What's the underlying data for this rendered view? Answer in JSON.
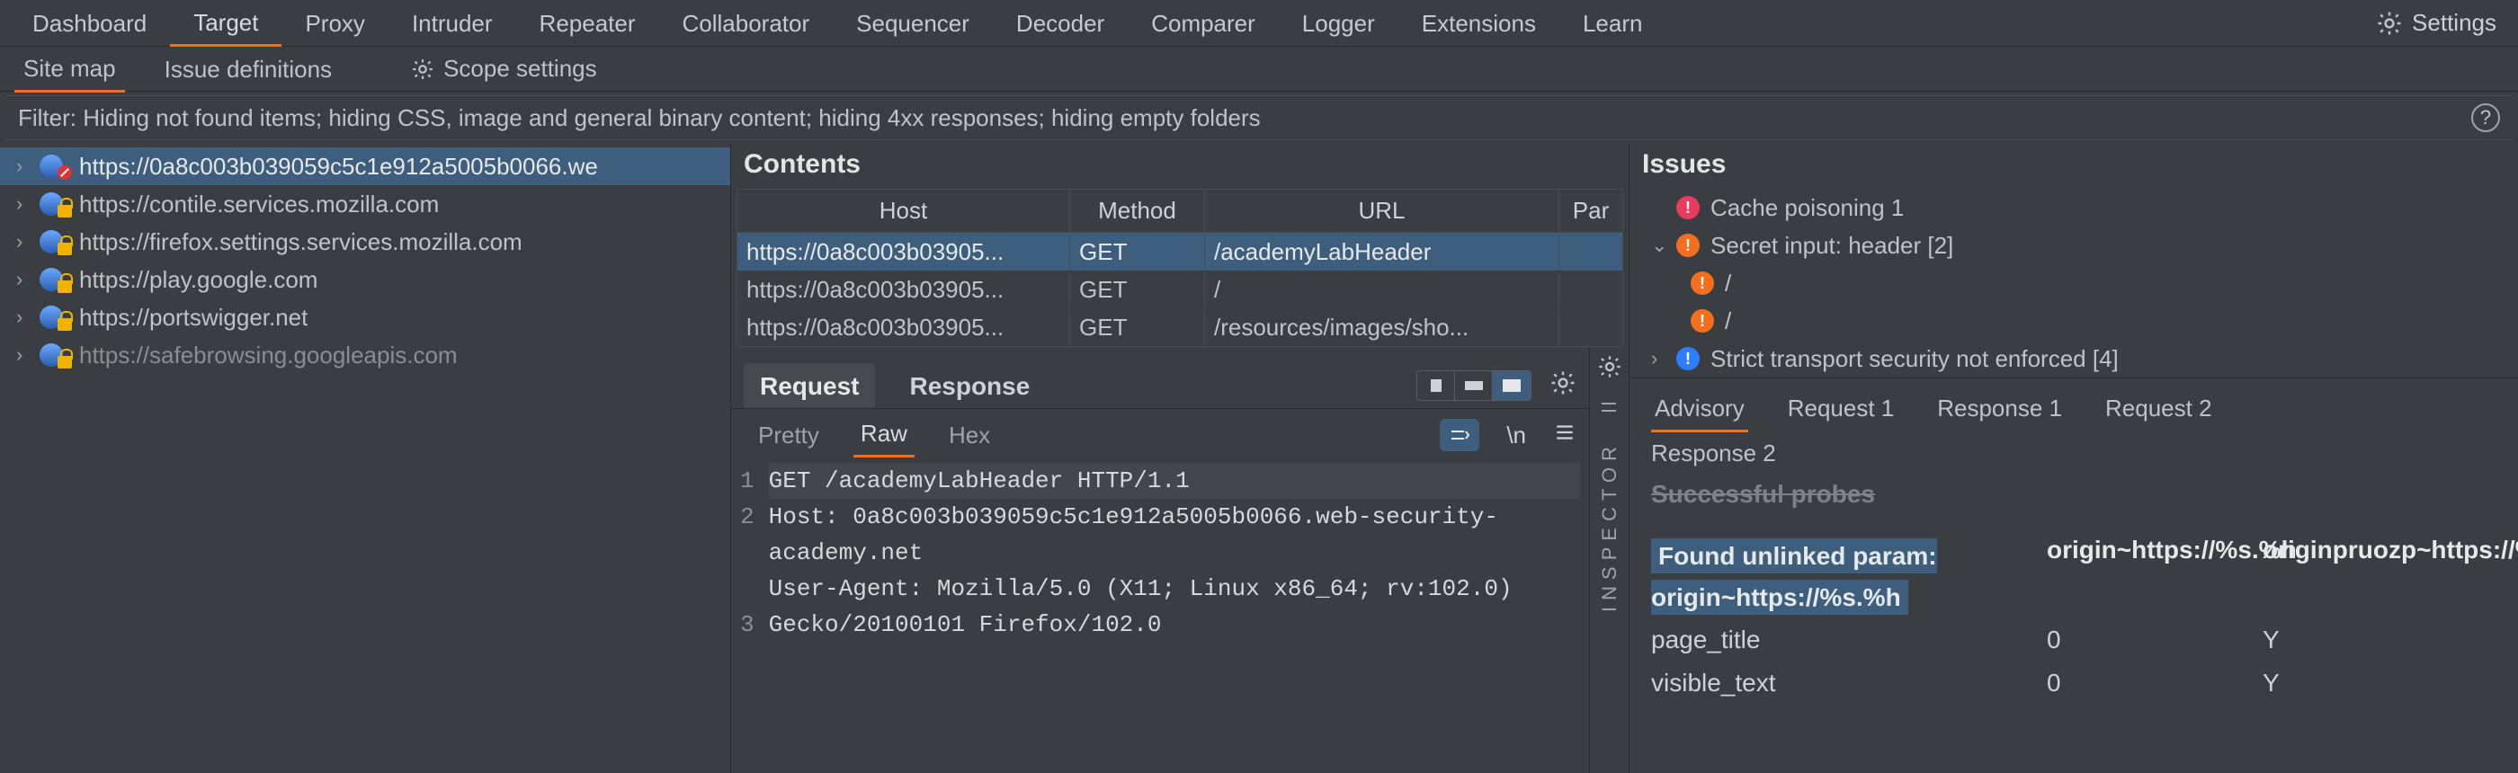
{
  "mainTabs": {
    "items": [
      "Dashboard",
      "Target",
      "Proxy",
      "Intruder",
      "Repeater",
      "Collaborator",
      "Sequencer",
      "Decoder",
      "Comparer",
      "Logger",
      "Extensions",
      "Learn"
    ],
    "activeIndex": 1,
    "settingsLabel": "Settings"
  },
  "subTabs": {
    "items": [
      "Site map",
      "Issue definitions"
    ],
    "activeIndex": 0,
    "scopeLabel": "Scope settings"
  },
  "filterText": "Filter: Hiding not found items;  hiding CSS, image and general binary content;  hiding 4xx responses;  hiding empty folders",
  "tree": [
    {
      "label": "https://0a8c003b039059c5c1e912a5005b0066.we",
      "secure": false,
      "selected": true
    },
    {
      "label": "https://contile.services.mozilla.com",
      "secure": true
    },
    {
      "label": "https://firefox.settings.services.mozilla.com",
      "secure": true
    },
    {
      "label": "https://play.google.com",
      "secure": true
    },
    {
      "label": "https://portswigger.net",
      "secure": true
    },
    {
      "label": "https://safebrowsing.googleapis.com",
      "secure": true,
      "dim": true
    }
  ],
  "contents": {
    "title": "Contents",
    "columns": {
      "host": "Host",
      "method": "Method",
      "url": "URL",
      "par": "Par"
    },
    "rows": [
      {
        "host": "https://0a8c003b03905...",
        "method": "GET",
        "url": "/academyLabHeader",
        "selected": true
      },
      {
        "host": "https://0a8c003b03905...",
        "method": "GET",
        "url": "/"
      },
      {
        "host": "https://0a8c003b03905...",
        "method": "GET",
        "url": "/resources/images/sho..."
      }
    ]
  },
  "reqresp": {
    "tabs": [
      "Request",
      "Response"
    ],
    "activeIndex": 0,
    "viewTabs": [
      "Pretty",
      "Raw",
      "Hex"
    ],
    "viewActive": 1,
    "nlLabel": "\\n"
  },
  "rawRequest": {
    "gutter": "1\n2\n\n\n3\n",
    "line1": "GET /academyLabHeader HTTP/1.1",
    "rest": "Host: 0a8c003b039059c5c1e912a5005b0066.web-security-academy.net\nUser-Agent: Mozilla/5.0 (X11; Linux x86_64; rv:102.0) Gecko/20100101 Firefox/102.0"
  },
  "inspectorLabel": "INSPECTOR",
  "issues": {
    "title": "Issues",
    "items": [
      {
        "color": "red",
        "arrow": "",
        "label": "Cache poisoning 1"
      },
      {
        "color": "orange",
        "arrow": "v",
        "label": "Secret input: header [2]"
      },
      {
        "color": "orange",
        "child": true,
        "label": "/"
      },
      {
        "color": "orange",
        "child": true,
        "label": "/"
      },
      {
        "color": "blue",
        "arrow": ">",
        "label": "Strict transport security not enforced [4]"
      }
    ]
  },
  "detailTabs": {
    "row1": [
      "Advisory",
      "Request 1",
      "Response 1",
      "Request 2"
    ],
    "row2": [
      "Response 2"
    ],
    "activeIndex": 0
  },
  "probes": {
    "heading": "Successful probes",
    "headerCells": [
      "Found unlinked param: origin~https://%s.%h",
      "origin~https://%s.%h",
      "originpruozp~https://%s.%h"
    ],
    "rows": [
      {
        "name": "page_title",
        "a": "0",
        "b": "Y"
      },
      {
        "name": "visible_text",
        "a": "0",
        "b": "Y"
      }
    ]
  }
}
